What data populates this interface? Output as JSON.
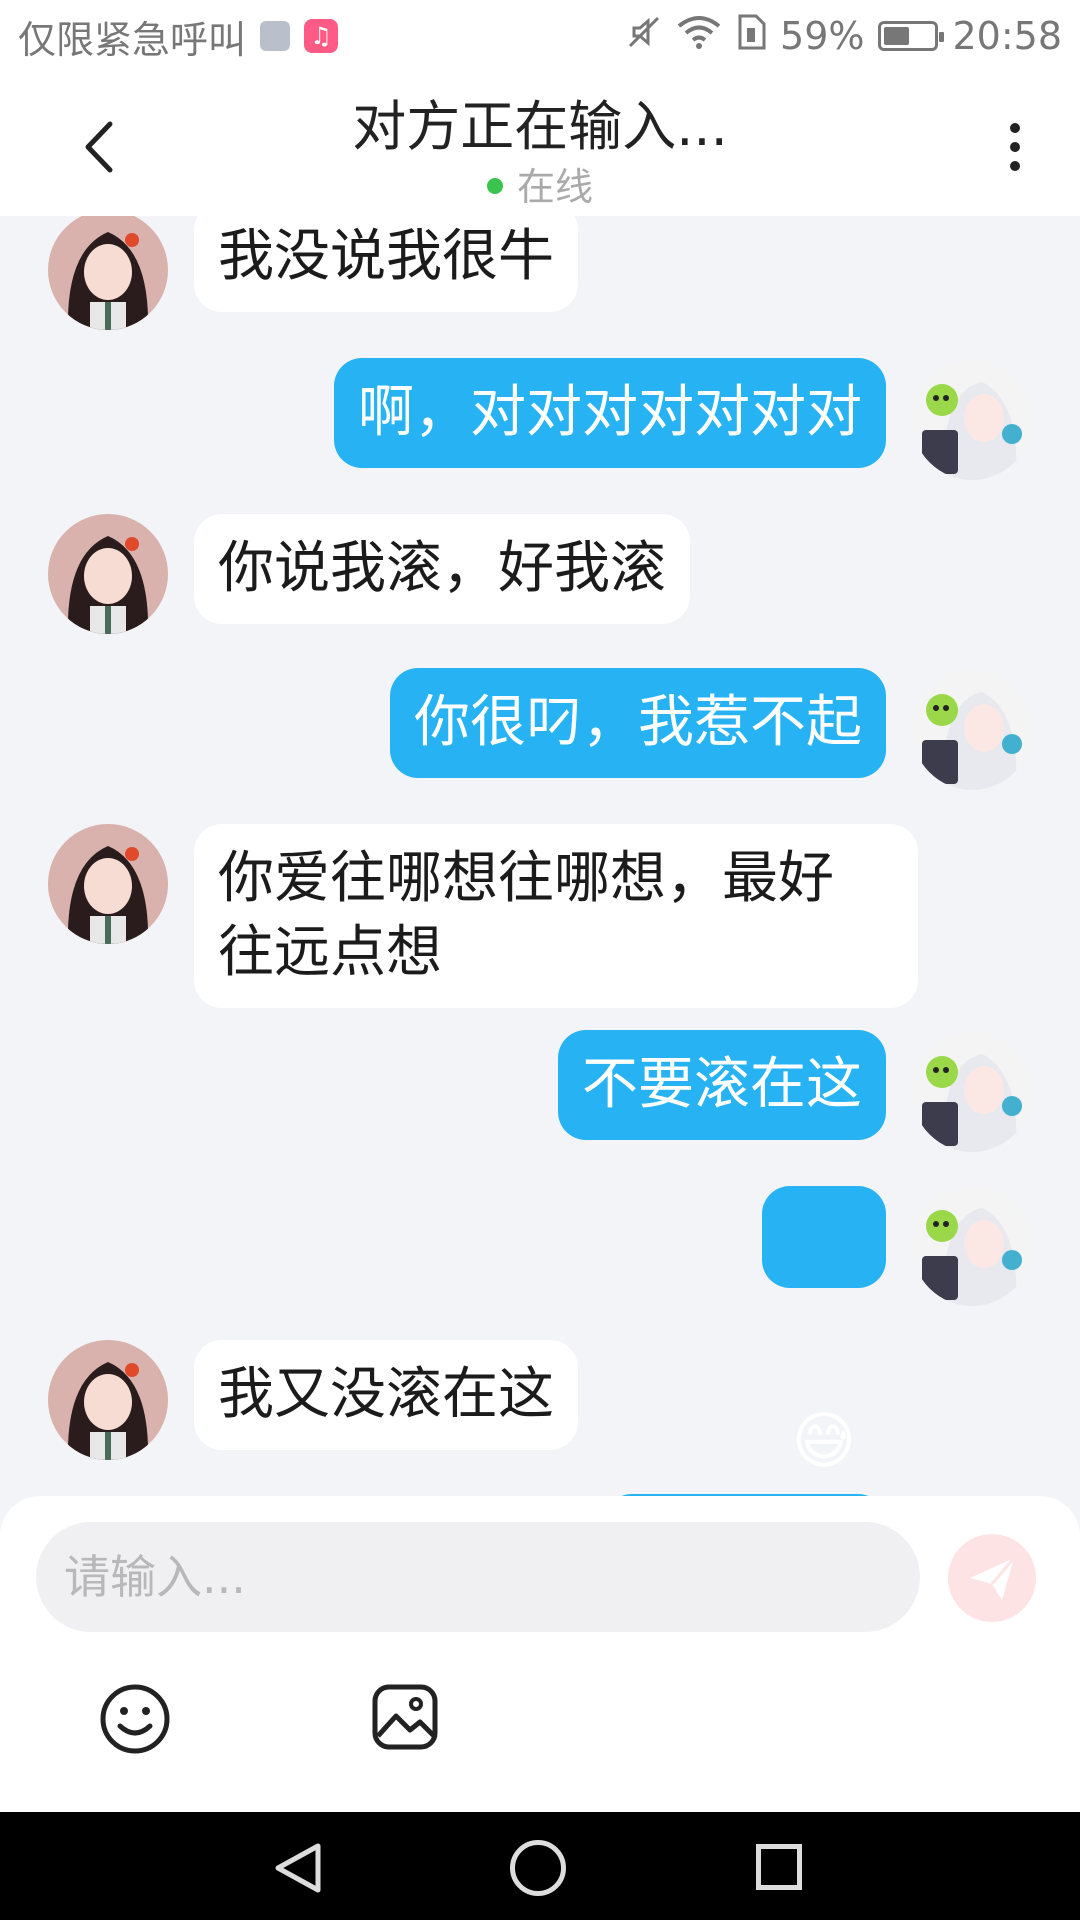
{
  "status_bar": {
    "carrier": "仅限紧急呼叫",
    "battery": "59%",
    "battery_level": 0.59,
    "time": "20:58",
    "icons": [
      "gallery-notification-icon",
      "music-notification-icon",
      "mute-icon",
      "wifi-icon",
      "sim-icon",
      "battery-icon"
    ]
  },
  "header": {
    "title": "对方正在输入...",
    "presence": "在线",
    "presence_color": "#3ac34d",
    "back_icon": "chevron-left-icon",
    "more_icon": "more-vertical-icon"
  },
  "messages": [
    {
      "side": "left",
      "text": "我没说我很牛"
    },
    {
      "side": "right",
      "text": "啊，对对对对对对对"
    },
    {
      "side": "left",
      "text": "你说我滚，好我滚"
    },
    {
      "side": "right",
      "text": "你很叼，我惹不起"
    },
    {
      "side": "left",
      "text": "你爱往哪想往哪想，最好\n往远点想"
    },
    {
      "side": "right",
      "text": "不要滚在这"
    },
    {
      "side": "right",
      "text": "",
      "emoji": "😅",
      "emoji_name": "sweat-smile-emoji"
    },
    {
      "side": "left",
      "text": "我又没滚在这"
    }
  ],
  "input": {
    "placeholder": "请输入...",
    "send_icon": "send-icon",
    "emoji_icon": "smiley-icon",
    "image_icon": "image-icon"
  },
  "colors": {
    "accent": "#27b3f3",
    "background": "#f3f4f8",
    "send_button_bg": "#fde3e3"
  }
}
